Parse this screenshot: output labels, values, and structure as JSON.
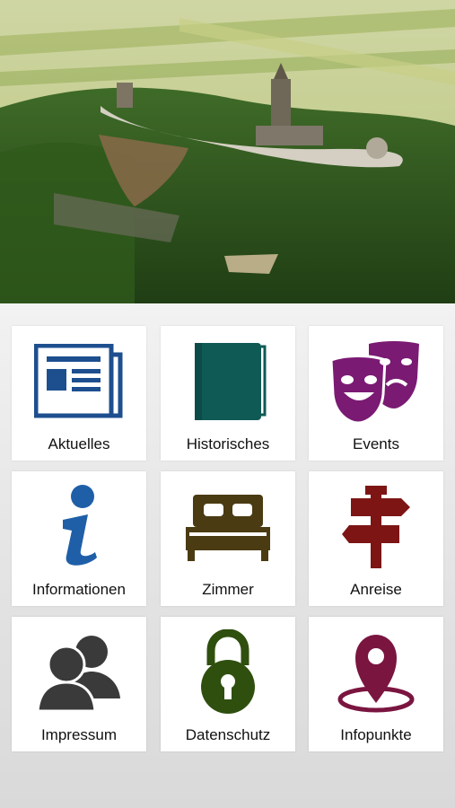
{
  "hero": {
    "icon": "aerial-photo-monument-on-forested-hill"
  },
  "menu": [
    {
      "label": "Aktuelles",
      "icon": "newspaper-icon",
      "color": "#1d4f8f"
    },
    {
      "label": "Historisches",
      "icon": "book-icon",
      "color": "#0f5a55"
    },
    {
      "label": "Events",
      "icon": "theater-masks-icon",
      "color": "#7a1a73"
    },
    {
      "label": "Informationen",
      "icon": "info-icon",
      "color": "#1f5fa8"
    },
    {
      "label": "Zimmer",
      "icon": "bed-icon",
      "color": "#4a3b12"
    },
    {
      "label": "Anreise",
      "icon": "signpost-icon",
      "color": "#7d1515"
    },
    {
      "label": "Impressum",
      "icon": "users-icon",
      "color": "#3a3a3a"
    },
    {
      "label": "Datenschutz",
      "icon": "padlock-icon",
      "color": "#2f4f0f"
    },
    {
      "label": "Infopunkte",
      "icon": "map-pin-icon",
      "color": "#7a1540"
    }
  ]
}
